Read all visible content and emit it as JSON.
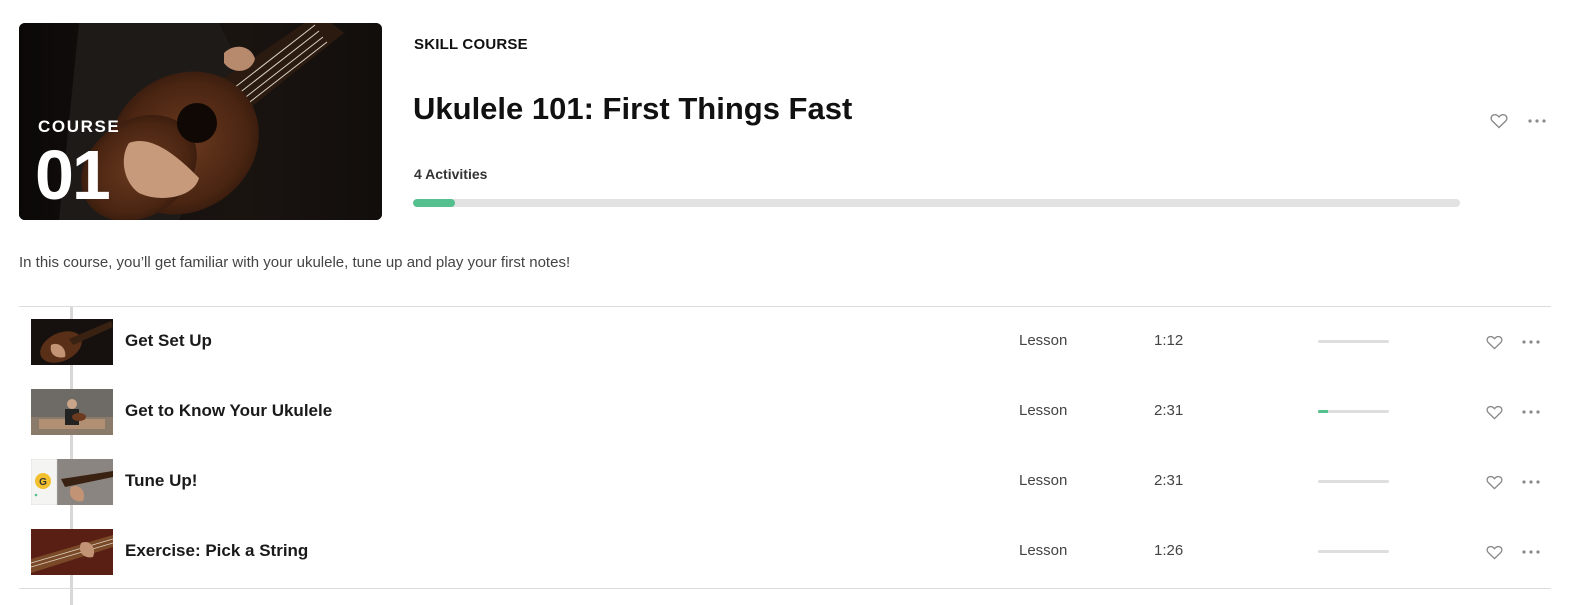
{
  "course": {
    "art_label": "COURSE",
    "art_number": "01",
    "kicker": "SKILL COURSE",
    "title": "Ukulele 101: First Things Fast",
    "activities": "4 Activities",
    "progress_fraction": 0.04,
    "description": "In this course, you’ll get familiar with your ukulele, tune up and play your first notes!"
  },
  "icons": {
    "favorite": "heart-outline-icon",
    "more": "more-horizontal-icon"
  },
  "colors": {
    "progress_fill": "#54c08d",
    "progress_track": "#e2e2e2"
  },
  "lessons": [
    {
      "title": "Get Set Up",
      "type": "Lesson",
      "duration": "1:12",
      "progress_fraction": 0
    },
    {
      "title": "Get to Know Your Ukulele",
      "type": "Lesson",
      "duration": "2:31",
      "progress_fraction": 0.14
    },
    {
      "title": "Tune Up!",
      "type": "Lesson",
      "duration": "2:31",
      "progress_fraction": 0
    },
    {
      "title": "Exercise: Pick a String",
      "type": "Lesson",
      "duration": "1:26",
      "progress_fraction": 0
    }
  ],
  "tuner_thumb": {
    "note": "G"
  }
}
